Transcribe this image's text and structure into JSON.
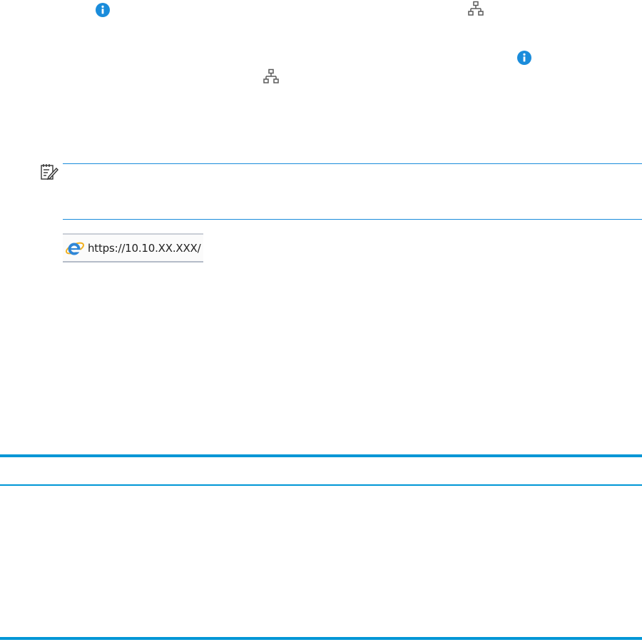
{
  "colors": {
    "accent_blue": "#1a8cdb",
    "icon_gray": "#5a5a5a",
    "rule_blue": "#0096d6"
  },
  "icons": {
    "info": "info-icon",
    "network": "network-icon",
    "note": "note-icon",
    "browser": "internet-explorer-icon"
  },
  "address_bar": {
    "url": "https://10.10.XX.XXX/"
  }
}
